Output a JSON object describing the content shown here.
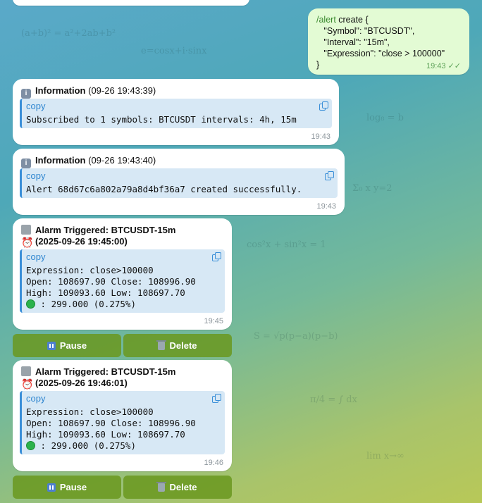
{
  "outgoing": {
    "command": "/alert",
    "text_after_command": " create {",
    "lines": [
      "   \"Symbol\": \"BTCUSDT\",",
      "   \"Interval\": \"15m\",",
      "   \"Expression\": \"close > 100000\"",
      "}"
    ],
    "time": "19:43",
    "status_icon": "double-check-icon"
  },
  "messages": [
    {
      "title": "Information",
      "timestamp": "(09-26 19:43:39)",
      "code_label": "copy",
      "code_lines": [
        "Subscribed to 1 symbols: BTCUSDT intervals: 4h, 15m"
      ],
      "time": "19:43"
    },
    {
      "title": "Information",
      "timestamp": "(09-26 19:43:40)",
      "code_label": "copy",
      "code_lines": [
        "Alert 68d67c6a802a79a8d4bf36a7 created successfully."
      ],
      "time": "19:43"
    }
  ],
  "alarms": [
    {
      "title": "Alarm Triggered: BTCUSDT-15m",
      "timestamp": "(2025-09-26 19:45:00)",
      "code_label": "copy",
      "line1": "Expression: close>100000",
      "line2": "Open: 108697.90 Close: 108996.90",
      "line3": "High: 109093.60 Low: 108697.70",
      "line4": " : 299.000 (0.275%)",
      "time": "19:45",
      "pause_label": "Pause",
      "delete_label": "Delete"
    },
    {
      "title": "Alarm Triggered: BTCUSDT-15m",
      "timestamp": "(2025-09-26 19:46:01)",
      "code_label": "copy",
      "line1": "Expression: close>100000",
      "line2": "Open: 108697.90 Close: 108996.90",
      "line3": "High: 109093.60 Low: 108697.70",
      "line4": " : 299.000 (0.275%)",
      "time": "19:46",
      "pause_label": "Pause",
      "delete_label": "Delete"
    }
  ],
  "colors": {
    "outgoing_bubble": "#e3fbd4",
    "incoming_bubble": "#ffffff",
    "code_background": "#d7e8f5",
    "accent": "#3a8fd8",
    "button": "#6a981e"
  }
}
